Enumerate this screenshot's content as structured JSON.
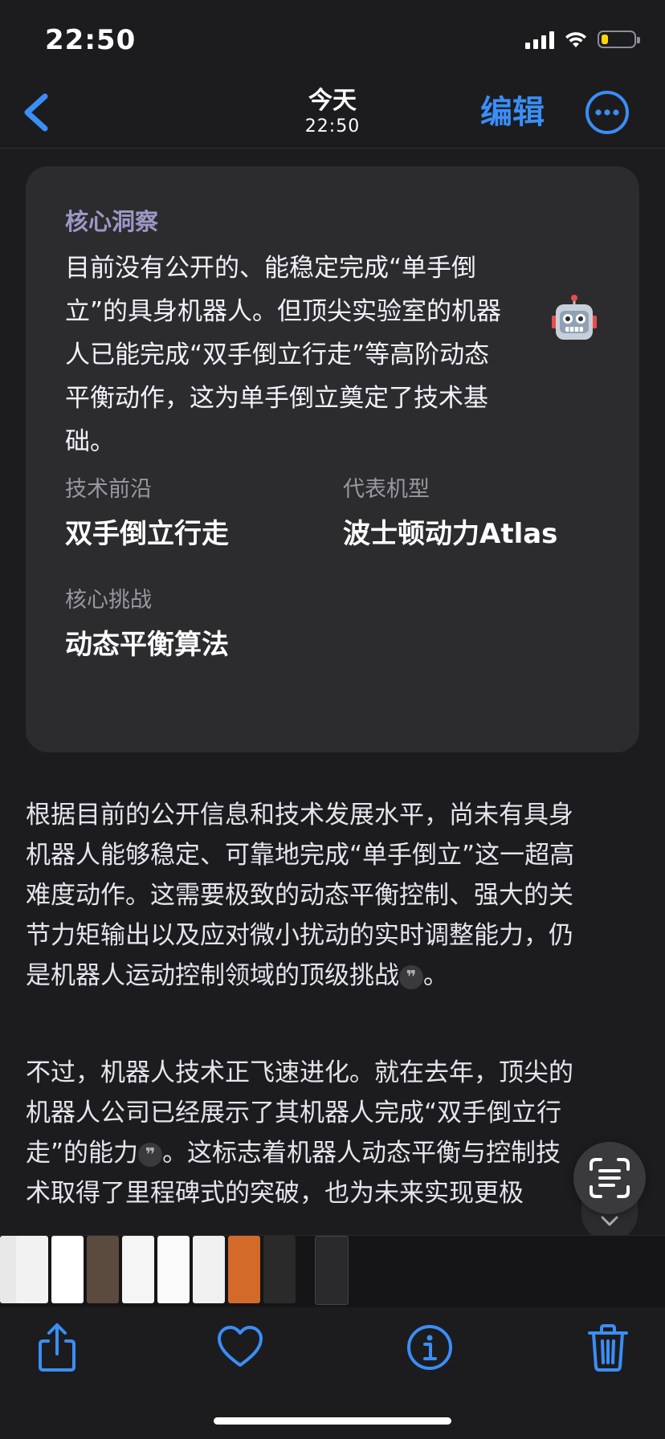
{
  "status_bar": {
    "time": "22:50",
    "battery_level": 0.22
  },
  "nav": {
    "title": "今天",
    "subtitle": "22:50",
    "edit_label": "编辑",
    "accent_color": "#3a8ef6"
  },
  "card": {
    "heading": "核心洞察",
    "body_lines": [
      "目前没有公开的、能稳定完成“单手倒",
      "立”的具身机器人。但顶尖实验室的机器",
      "人已能完成“双手倒立行走”等高阶动态",
      "平衡动作，这为单手倒立奠定了技术基",
      "础。"
    ],
    "robot_icon": "robot-face-emoji",
    "stats": [
      {
        "label": "技术前沿",
        "value": "双手倒立行走"
      },
      {
        "label": "代表机型",
        "value": "波士顿动力Atlas"
      },
      {
        "label": "核心挑战",
        "value": "动态平衡算法"
      }
    ]
  },
  "paragraph1_lines": [
    "根据目前的公开信息和技术发展水平，尚未有具身",
    "机器人能够稳定、可靠地完成“单手倒立”这一超高",
    "难度动作。这需要极致的动态平衡控制、强大的关",
    "节力矩输出以及应对微小扰动的实时调整能力，仍",
    "是机器人运动控制领域的顶级挑战",
    "。"
  ],
  "paragraph2_lines": [
    "不过，机器人技术正飞速进化。就在去年，顶尖的",
    "机器人公司已经展示了其机器人完成“双手倒立行",
    "走”的能力",
    "。这标志着机器人动态平衡与控制技",
    "术取得了里程碑式的突破，也为未来实现更极"
  ],
  "citation_glyph": "❞",
  "toolbar": {
    "icons": [
      "share-icon",
      "heart-icon",
      "info-icon",
      "trash-icon"
    ]
  }
}
